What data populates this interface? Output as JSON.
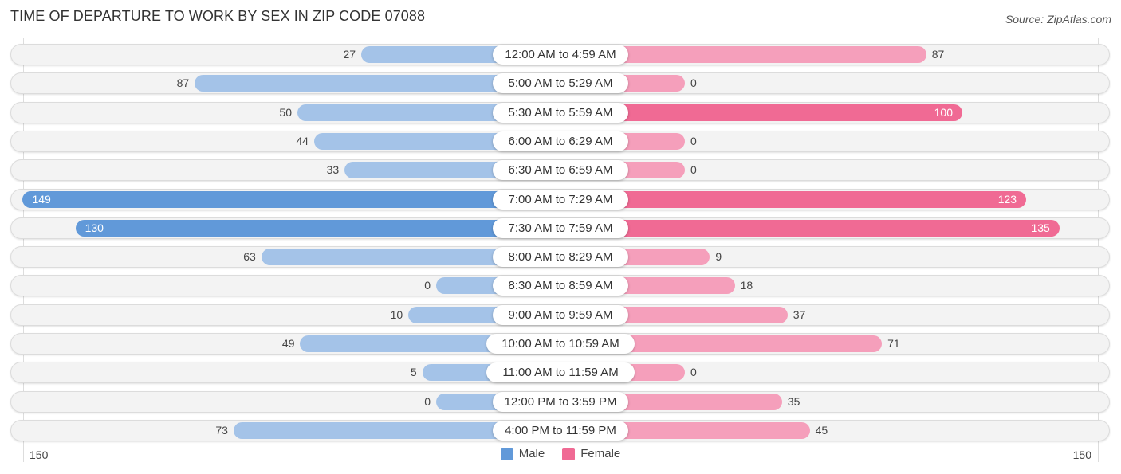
{
  "title": "TIME OF DEPARTURE TO WORK BY SEX IN ZIP CODE 07088",
  "source": "Source: ZipAtlas.com",
  "colors": {
    "male": "#a4c3e8",
    "male_strong": "#6199d9",
    "female": "#f59fbb",
    "female_strong": "#f06a94"
  },
  "chart_data": {
    "type": "bar",
    "orientation": "horizontal-diverging",
    "title": "TIME OF DEPARTURE TO WORK BY SEX IN ZIP CODE 07088",
    "categories": [
      "12:00 AM to 4:59 AM",
      "5:00 AM to 5:29 AM",
      "5:30 AM to 5:59 AM",
      "6:00 AM to 6:29 AM",
      "6:30 AM to 6:59 AM",
      "7:00 AM to 7:29 AM",
      "7:30 AM to 7:59 AM",
      "8:00 AM to 8:29 AM",
      "8:30 AM to 8:59 AM",
      "9:00 AM to 9:59 AM",
      "10:00 AM to 10:59 AM",
      "11:00 AM to 11:59 AM",
      "12:00 PM to 3:59 PM",
      "4:00 PM to 11:59 PM"
    ],
    "series": [
      {
        "name": "Male",
        "values": [
          27,
          87,
          50,
          44,
          33,
          149,
          130,
          63,
          0,
          10,
          49,
          5,
          0,
          73
        ]
      },
      {
        "name": "Female",
        "values": [
          87,
          0,
          100,
          0,
          0,
          123,
          135,
          9,
          18,
          37,
          71,
          0,
          35,
          45
        ]
      }
    ],
    "xlim": [
      150,
      150
    ],
    "axis_tick_labels": {
      "left": "150",
      "right": "150"
    },
    "legend": {
      "position": "bottom-center",
      "entries": [
        "Male",
        "Female"
      ]
    },
    "grid": false
  }
}
